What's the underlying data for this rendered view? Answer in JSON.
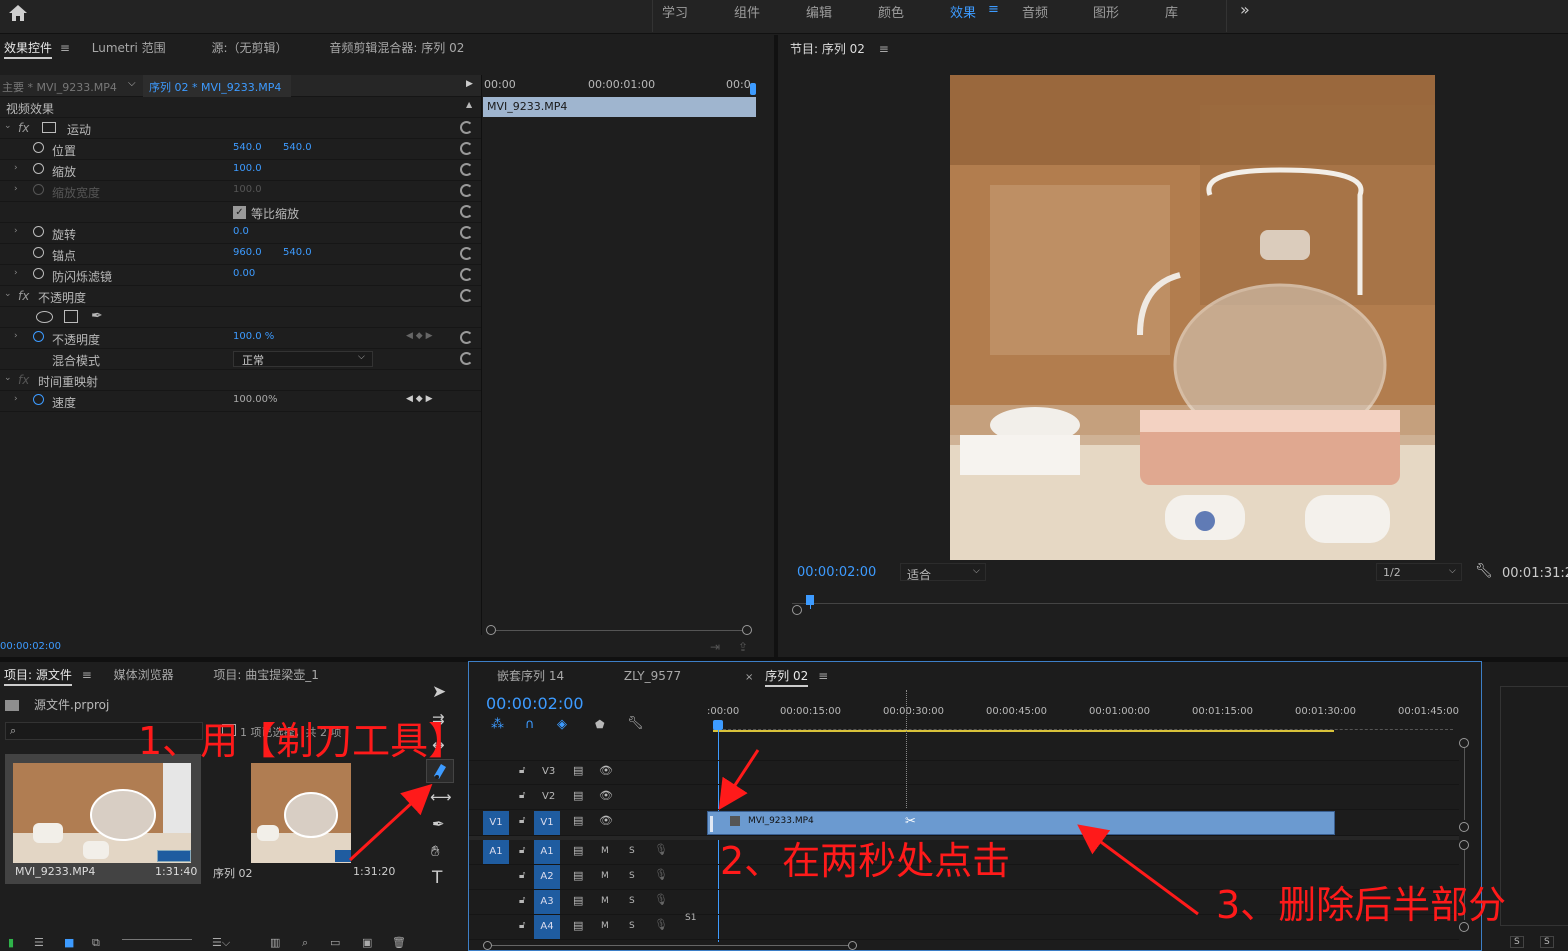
{
  "workspaces": [
    "学习",
    "组件",
    "编辑",
    "颜色",
    "效果",
    "音频",
    "图形",
    "库"
  ],
  "workspace_active": "效果",
  "more_icon": "»",
  "effect_controls": {
    "tabs": [
      "效果控件",
      "Lumetri 范围",
      "源:（无剪辑）",
      "音频剪辑混合器: 序列 02"
    ],
    "master_clip": "主要 * MVI_9233.MP4",
    "sequence_clip": "序列 02 * MVI_9233.MP4",
    "section": "视频效果",
    "ruler": [
      "00:00",
      "00:00:01:00",
      "00:0"
    ],
    "clip_bar": "MVI_9233.MP4",
    "motion": "运动",
    "position_label": "位置",
    "position_x": "540.0",
    "position_y": "540.0",
    "scale_label": "缩放",
    "scale": "100.0",
    "scale_width_label": "缩放宽度",
    "scale_width": "100.0",
    "uniform_scale": "等比缩放",
    "rotation_label": "旋转",
    "rotation": "0.0",
    "anchor_label": "锚点",
    "anchor_x": "960.0",
    "anchor_y": "540.0",
    "flicker_label": "防闪烁滤镜",
    "flicker": "0.00",
    "opacity_group": "不透明度",
    "opacity_label": "不透明度",
    "opacity": "100.0 %",
    "blend_label": "混合模式",
    "blend": "正常",
    "time_remap": "时间重映射",
    "speed_label": "速度",
    "speed": "100.00%",
    "current_time": "00:00:02:00"
  },
  "program": {
    "title": "节目: 序列 02",
    "timecode": "00:00:02:00",
    "fit": "适合",
    "resolution": "1/2",
    "duration": "00:01:31:2"
  },
  "project": {
    "tabs": [
      "项目: 源文件",
      "媒体浏览器",
      "项目: 曲宝提梁壶_1"
    ],
    "file": "源文件.prproj",
    "items_info": "1 项已选择，共 2 项",
    "items": [
      {
        "name": "MVI_9233.MP4",
        "duration": "1:31:40"
      },
      {
        "name": "序列 02",
        "duration": "1:31:20"
      }
    ]
  },
  "timeline": {
    "tabs": [
      "嵌套序列 14",
      "ZLY_9577",
      "序列 02"
    ],
    "timecode": "00:00:02:00",
    "ruler": [
      ":00:00",
      "00:00:15:00",
      "00:00:30:00",
      "00:00:45:00",
      "00:01:00:00",
      "00:01:15:00",
      "00:01:30:00",
      "00:01:45:00"
    ],
    "video_tracks": [
      "V3",
      "V2",
      "V1"
    ],
    "audio_tracks": [
      "A1",
      "A2",
      "A3",
      "A4"
    ],
    "src_v": "V1",
    "src_a": "A1",
    "clip": "MVI_9233.MP4",
    "m": "M",
    "s": "S",
    "end_label": "S1"
  },
  "annotations": {
    "step1": "1、用【剃刀工具】",
    "step2": "2、在两秒处点击",
    "step3": "3、删除后半部分"
  },
  "colors": {
    "accent": "#3d9bff",
    "clip": "#6b9ad0",
    "annotation": "#ff1a1a",
    "track_on": "#1f5ca0"
  }
}
